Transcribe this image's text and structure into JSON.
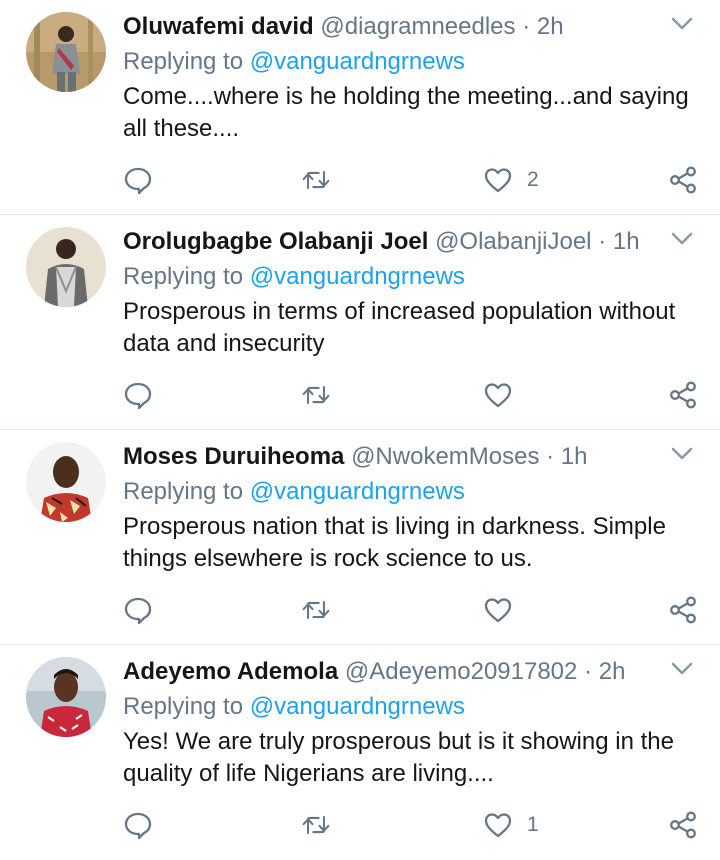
{
  "reply_prefix": "Replying to",
  "tweets": [
    {
      "name": "Oluwafemi david",
      "handle": "@diagramneedles",
      "time": "2h",
      "reply_to": "@vanguardngrnews",
      "text": "Come....where is he holding the meeting...and saying all these....",
      "likes": "2",
      "avatar": "avatar-photo-man-standing-grey-outfit"
    },
    {
      "name": "Orolugbagbe Olabanji Joel",
      "handle": "@OlabanjiJoel",
      "time": "1h",
      "reply_to": "@vanguardngrnews",
      "text": "Prosperous in terms of increased population without data and insecurity",
      "likes": "",
      "avatar": "avatar-photo-man-grey-vest"
    },
    {
      "name": "Moses Duruiheoma",
      "handle": "@NwokemMoses",
      "time": "1h",
      "reply_to": "@vanguardngrnews",
      "text": "Prosperous nation that is living in darkness. Simple things elsewhere is rock science to us.",
      "likes": "",
      "avatar": "avatar-photo-man-patterned-shirt"
    },
    {
      "name": "Adeyemo Ademola",
      "handle": "@Adeyemo20917802",
      "time": "2h",
      "reply_to": "@vanguardngrnews",
      "text": "Yes! We are truly prosperous but is it showing in the quality of life Nigerians are living....",
      "likes": "1",
      "avatar": "avatar-photo-man-red-shirt"
    }
  ],
  "colors": {
    "name": "#14171a",
    "secondary": "#657786",
    "link": "#1da1f2",
    "divider": "#e1e8ed"
  }
}
